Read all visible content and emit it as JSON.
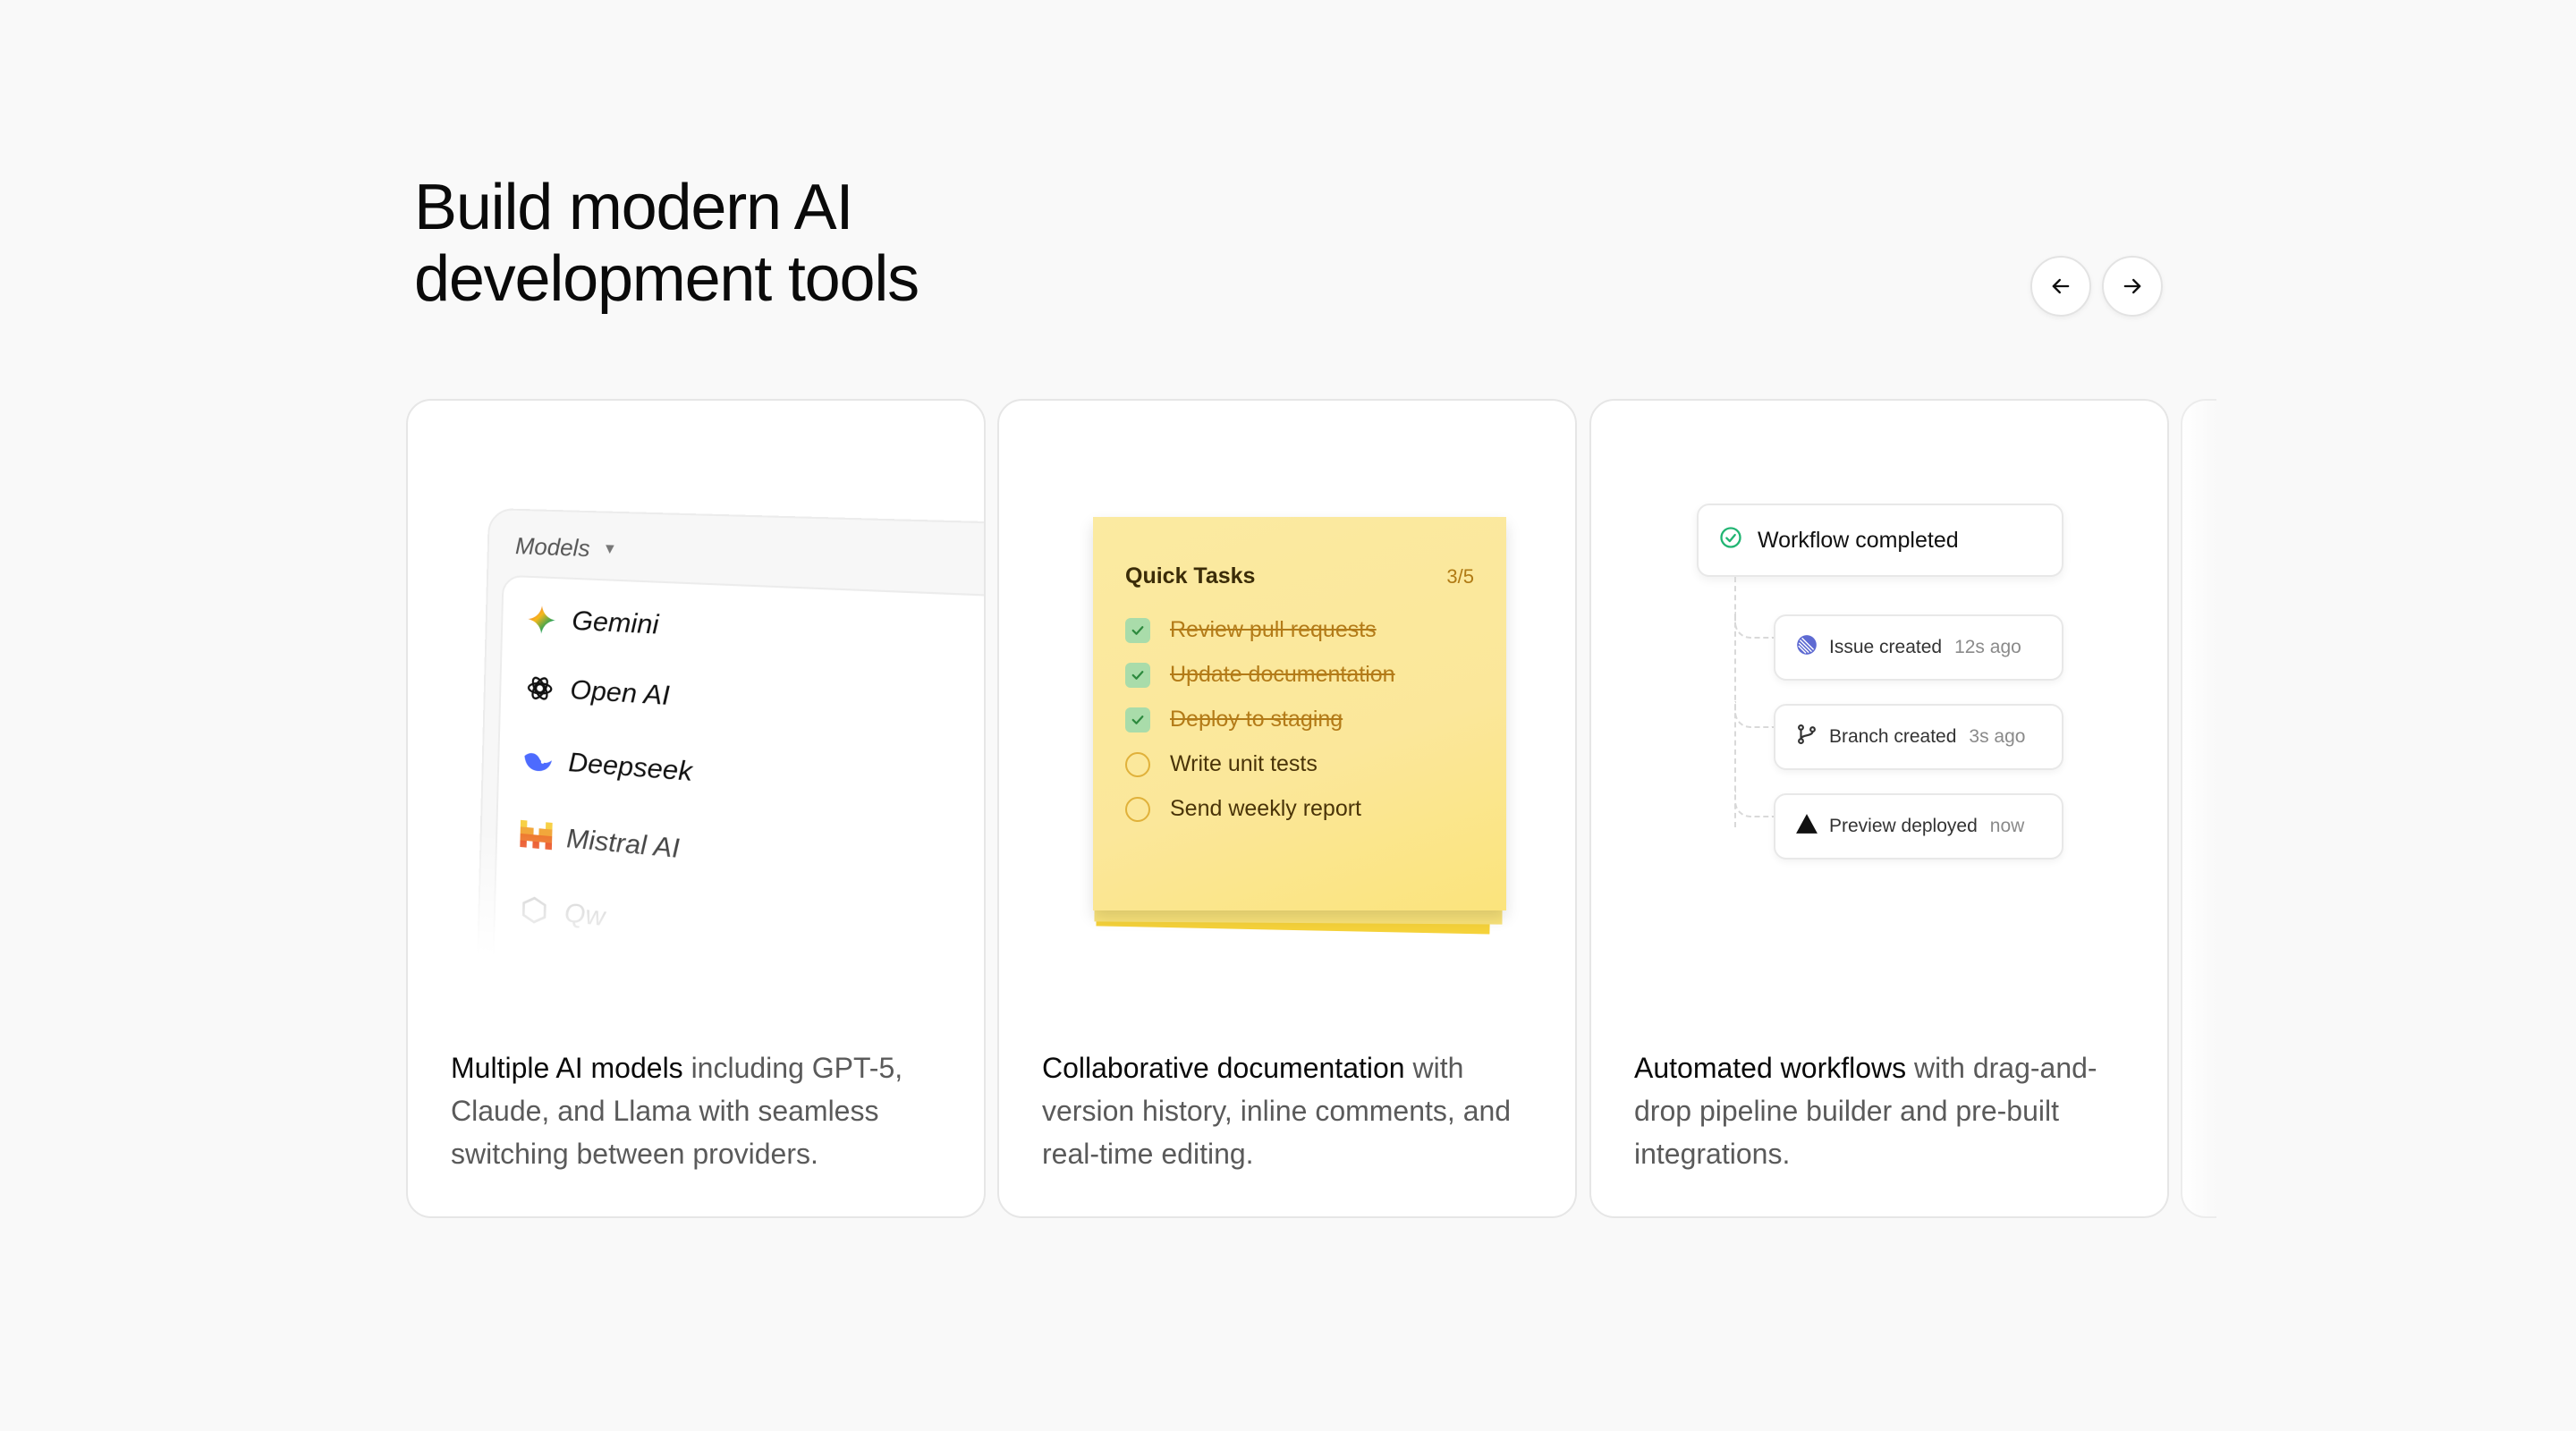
{
  "headline": {
    "line1": "Build modern AI",
    "line2": "development tools"
  },
  "nav": {
    "prev_icon": "arrow-left-icon",
    "next_icon": "arrow-right-icon"
  },
  "cards": [
    {
      "caption_strong": "Multiple AI models",
      "caption_rest": " including GPT-5, Claude, and Llama with seamless switching between providers.",
      "models_header": "Models",
      "models": [
        {
          "label": "Gemini",
          "icon": "gemini-icon"
        },
        {
          "label": "Open AI",
          "icon": "openai-icon"
        },
        {
          "label": "Deepseek",
          "icon": "deepseek-icon"
        },
        {
          "label": "Mistral AI",
          "icon": "mistral-icon"
        },
        {
          "label": "Qw",
          "icon": "qwen-icon"
        }
      ]
    },
    {
      "caption_strong": "Collaborative documentation",
      "caption_rest": " with version history, inline comments, and real-time editing.",
      "sticky_title": "Quick Tasks",
      "sticky_count": "3/5",
      "tasks": [
        {
          "label": "Review pull requests",
          "done": true
        },
        {
          "label": "Update documentation",
          "done": true
        },
        {
          "label": "Deploy to staging",
          "done": true
        },
        {
          "label": "Write unit tests",
          "done": false
        },
        {
          "label": "Send weekly report",
          "done": false
        }
      ]
    },
    {
      "caption_strong": "Automated workflows",
      "caption_rest": " with drag-and-drop pipeline builder and pre-built integrations.",
      "workflow_title": "Workflow completed",
      "events": [
        {
          "label": "Issue created",
          "time": "12s ago",
          "icon": "linear-icon"
        },
        {
          "label": "Branch created",
          "time": "3s ago",
          "icon": "git-branch-icon"
        },
        {
          "label": "Preview deployed",
          "time": "now",
          "icon": "vercel-triangle-icon"
        }
      ]
    }
  ],
  "colors": {
    "background": "#f9f9f9",
    "sticky_yellow": "#fbe79a",
    "check_green": "#a9dcaa",
    "success_green": "#22b573"
  }
}
